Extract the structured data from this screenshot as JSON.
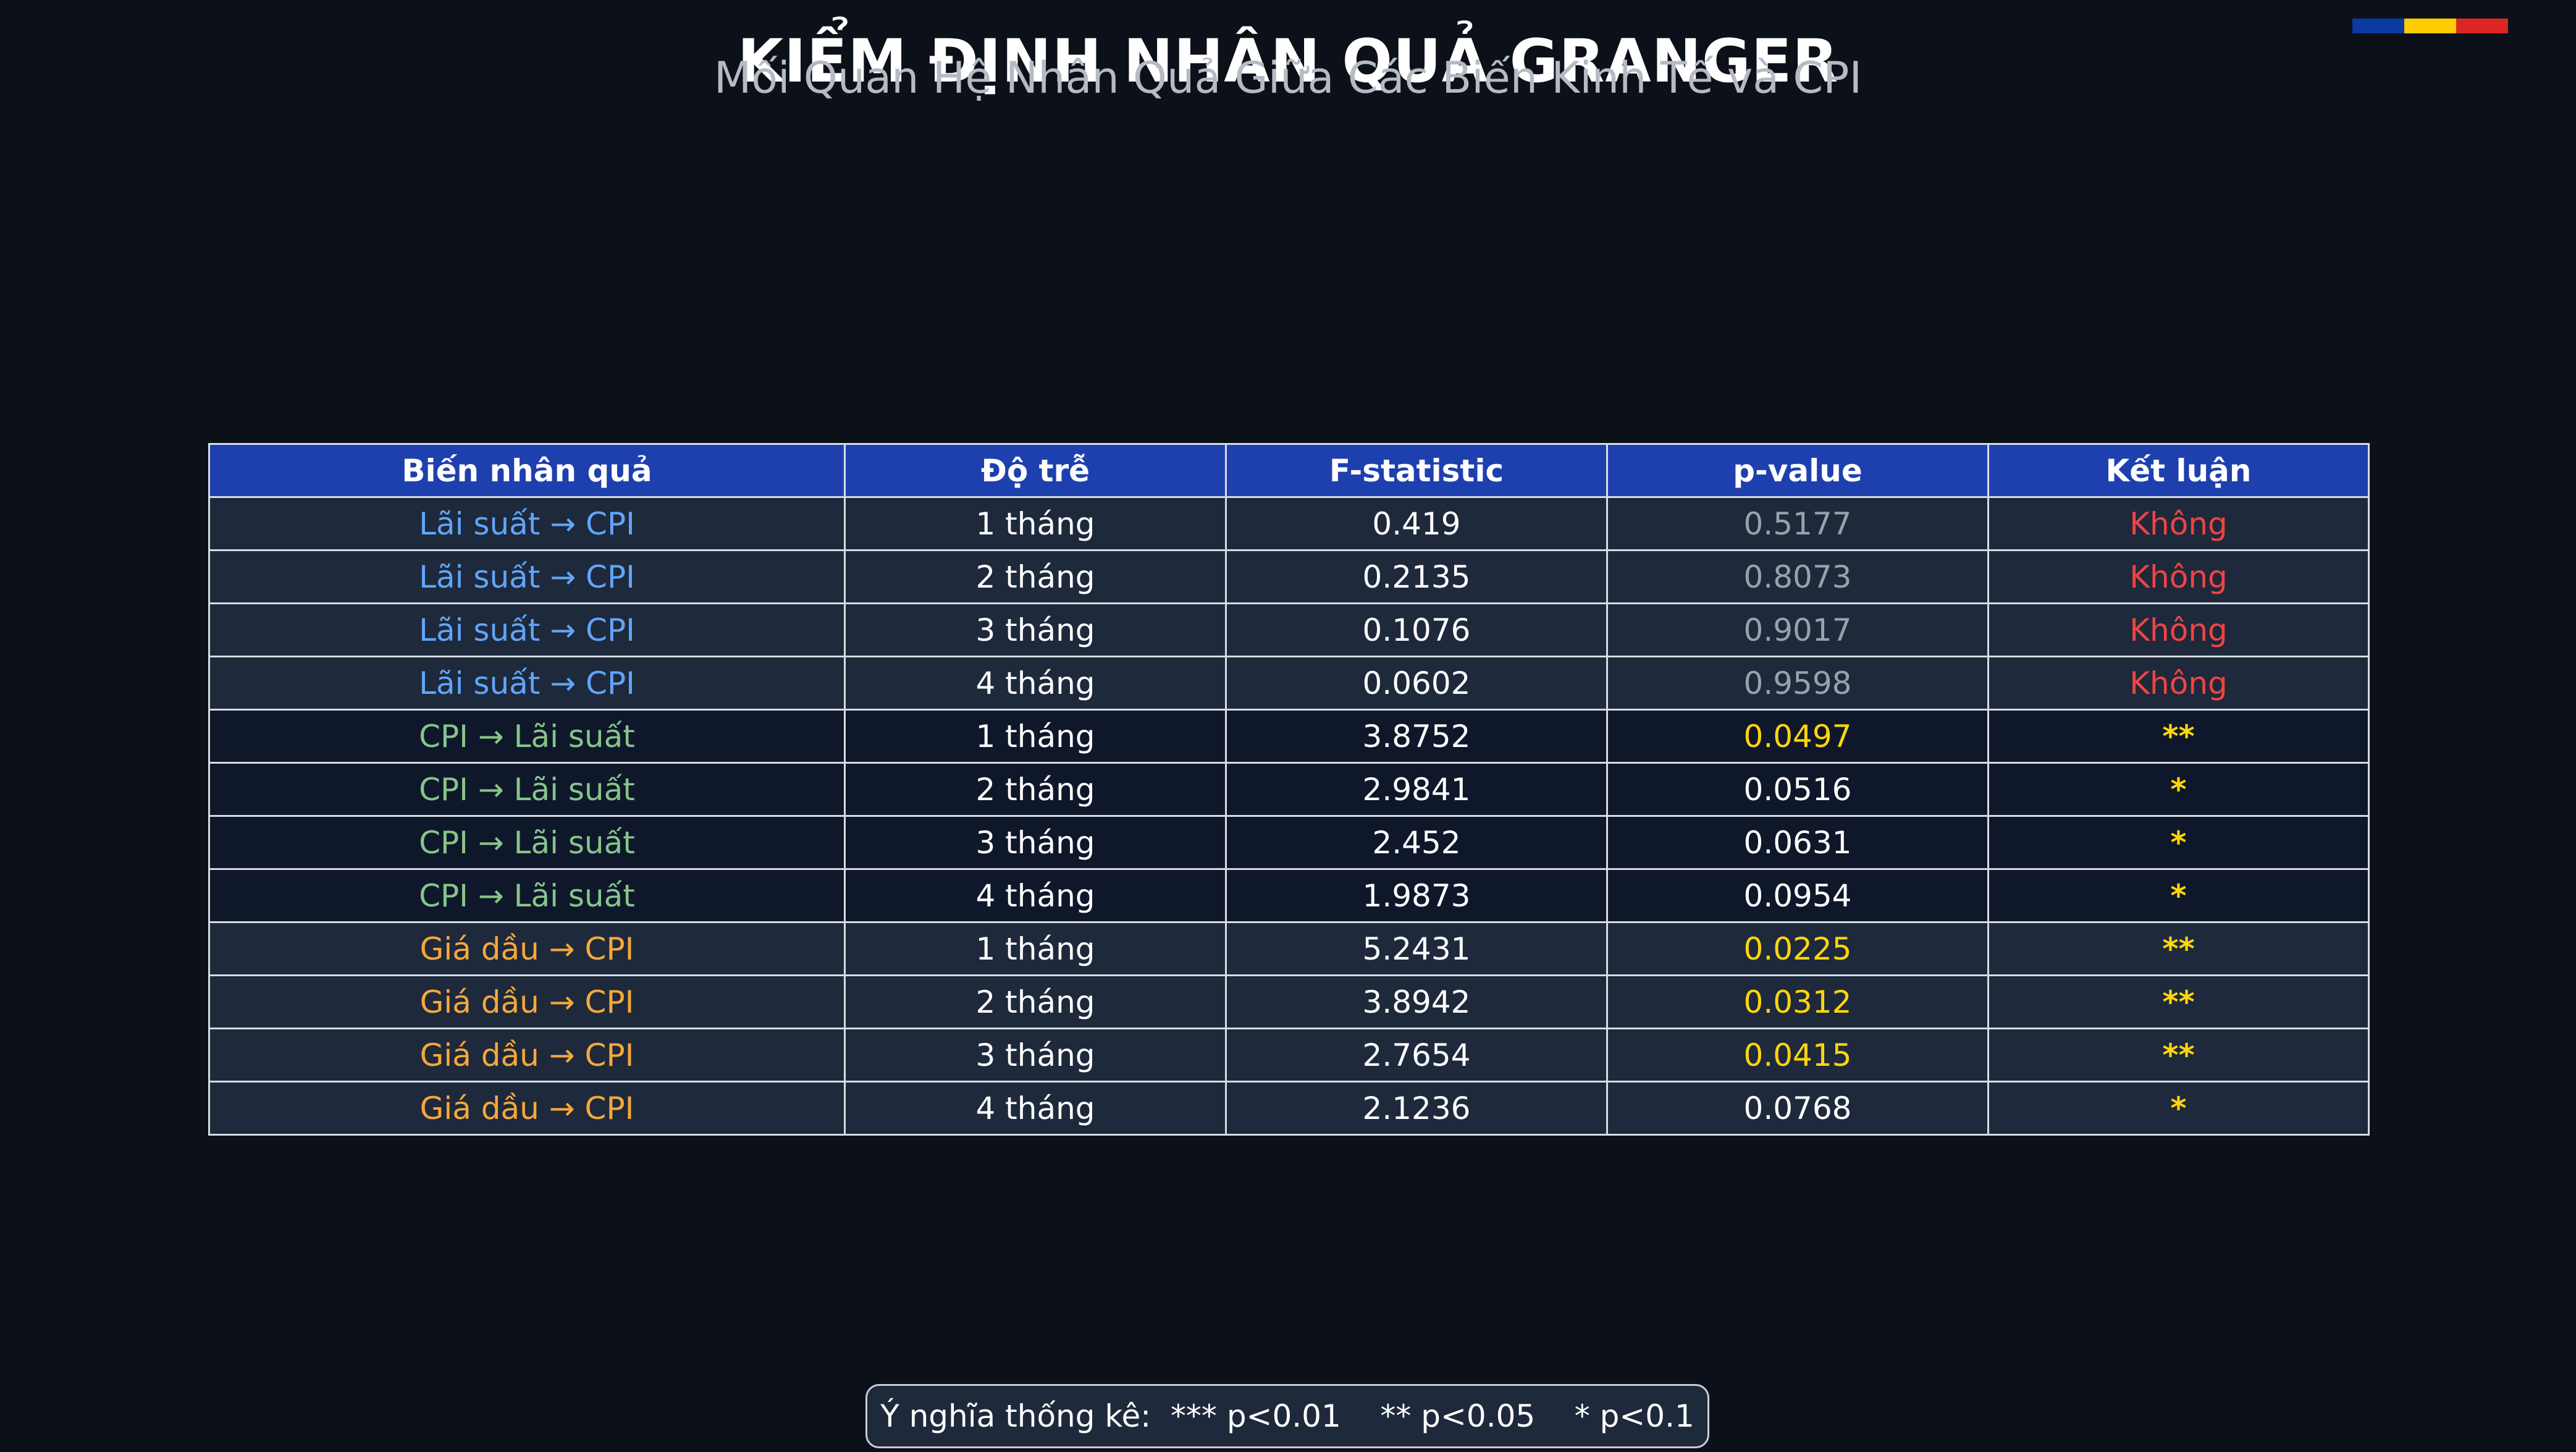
{
  "colors": {
    "background": "#0c1018",
    "header": "#1e40af",
    "row_dark_blue": "#1e293b",
    "row_navy": "#0f172a",
    "series_laisuat_cpi": "#60a5fa",
    "series_cpi_laisuat": "#86c58a",
    "series_giadau_cpi": "#f5a83a",
    "significant": "#ffd60a",
    "not_significant": "#ef4444",
    "flag": [
      "#0b3aa4",
      "#ffcc00",
      "#dc2626"
    ]
  },
  "chart_data": {
    "type": "table",
    "title": "KIỂM ĐỊNH NHÂN QUẢ GRANGER",
    "subtitle": "Mối Quan Hệ Nhân Quả Giữa Các Biến Kinh Tế và CPI",
    "columns": [
      "Biến nhân quả",
      "Độ trễ",
      "F-statistic",
      "p-value",
      "Kết luận"
    ],
    "rows": [
      {
        "pair": "Lãi suất → CPI",
        "lag": "1 tháng",
        "f": "0.419",
        "p": "0.5177",
        "conclusion": "Không",
        "group": "laisuat_cpi",
        "p_style": "grey",
        "conclusion_style": "red"
      },
      {
        "pair": "Lãi suất → CPI",
        "lag": "2 tháng",
        "f": "0.2135",
        "p": "0.8073",
        "conclusion": "Không",
        "group": "laisuat_cpi",
        "p_style": "grey",
        "conclusion_style": "red"
      },
      {
        "pair": "Lãi suất → CPI",
        "lag": "3 tháng",
        "f": "0.1076",
        "p": "0.9017",
        "conclusion": "Không",
        "group": "laisuat_cpi",
        "p_style": "grey",
        "conclusion_style": "red"
      },
      {
        "pair": "Lãi suất → CPI",
        "lag": "4 tháng",
        "f": "0.0602",
        "p": "0.9598",
        "conclusion": "Không",
        "group": "laisuat_cpi",
        "p_style": "grey",
        "conclusion_style": "red"
      },
      {
        "pair": "CPI → Lãi suất",
        "lag": "1 tháng",
        "f": "3.8752",
        "p": "0.0497",
        "conclusion": "**",
        "group": "cpi_laisuat",
        "p_style": "yellow",
        "conclusion_style": "stars"
      },
      {
        "pair": "CPI → Lãi suất",
        "lag": "2 tháng",
        "f": "2.9841",
        "p": "0.0516",
        "conclusion": "*",
        "group": "cpi_laisuat",
        "p_style": "white",
        "conclusion_style": "stars"
      },
      {
        "pair": "CPI → Lãi suất",
        "lag": "3 tháng",
        "f": "2.452",
        "p": "0.0631",
        "conclusion": "*",
        "group": "cpi_laisuat",
        "p_style": "white",
        "conclusion_style": "stars"
      },
      {
        "pair": "CPI → Lãi suất",
        "lag": "4 tháng",
        "f": "1.9873",
        "p": "0.0954",
        "conclusion": "*",
        "group": "cpi_laisuat",
        "p_style": "white",
        "conclusion_style": "stars"
      },
      {
        "pair": "Giá dầu → CPI",
        "lag": "1 tháng",
        "f": "5.2431",
        "p": "0.0225",
        "conclusion": "**",
        "group": "giadau_cpi",
        "p_style": "yellow",
        "conclusion_style": "stars"
      },
      {
        "pair": "Giá dầu → CPI",
        "lag": "2 tháng",
        "f": "3.8942",
        "p": "0.0312",
        "conclusion": "**",
        "group": "giadau_cpi",
        "p_style": "yellow",
        "conclusion_style": "stars"
      },
      {
        "pair": "Giá dầu → CPI",
        "lag": "3 tháng",
        "f": "2.7654",
        "p": "0.0415",
        "conclusion": "**",
        "group": "giadau_cpi",
        "p_style": "yellow",
        "conclusion_style": "stars"
      },
      {
        "pair": "Giá dầu → CPI",
        "lag": "4 tháng",
        "f": "2.1236",
        "p": "0.0768",
        "conclusion": "*",
        "group": "giadau_cpi",
        "p_style": "white",
        "conclusion_style": "stars"
      }
    ],
    "legend": "Ý nghĩa thống kê:  *** p<0.01    ** p<0.05    * p<0.1"
  }
}
